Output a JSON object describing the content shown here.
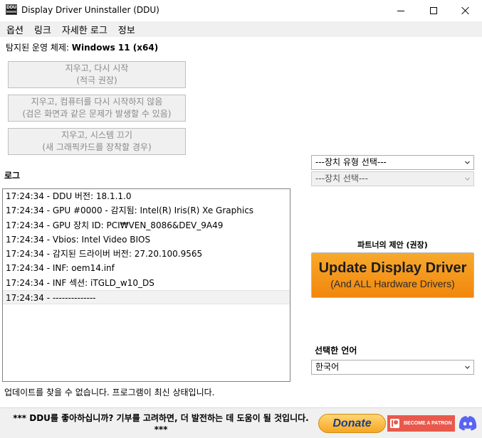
{
  "window": {
    "title": "Display Driver Uninstaller (DDU)",
    "icon_text": "DDU"
  },
  "menu": [
    "옵션",
    "링크",
    "자세한 로그",
    "정보"
  ],
  "os": {
    "label": "탐지된 운영 체제:",
    "value": "Windows 11 (x64)"
  },
  "buttons": {
    "clean_restart": [
      "지우고, 다시 시작",
      "(적극 권장)"
    ],
    "clean_no_restart": [
      "지우고, 컴퓨터를 다시 시작하지 않음",
      "(검은 화면과 같은 문제가 발생할 수 있음)"
    ],
    "clean_shutdown": [
      "지우고, 시스템 끄기",
      "(새 그래픽카드를 장착할 경우)"
    ]
  },
  "device_type_select": "---장치 유형 선택---",
  "device_select": "---장치 선택---",
  "log": {
    "label": "로그",
    "lines": [
      "17:24:34 - DDU 버전: 18.1.1.0",
      "17:24:34 - GPU #0000 - 감지됨: Intel(R) Iris(R) Xe Graphics",
      "17:24:34 - GPU 장치 ID: PCI₩VEN_8086&DEV_9A49",
      "17:24:34 - Vbios: Intel Video BIOS",
      "17:24:34 - 감지된 드라이버 버전: 27.20.100.9565",
      "17:24:34 - INF: oem14.inf",
      "17:24:34 - INF 섹션: iTGLD_w10_DS",
      "17:24:34 - --------------"
    ]
  },
  "partner": {
    "label": "파트너의 제안 (권장)",
    "ad_title": "Update Display Driver",
    "ad_subtitle": "(And ALL Hardware Drivers)"
  },
  "language": {
    "label": "선택한 언어",
    "value": "한국어"
  },
  "status": "업데이트를 찾을 수 없습니다. 프로그램이 최신 상태입니다.",
  "footer": {
    "message_line1": "*** DDU를 좋아하십니까? 기부를 고려하면, 더 발전하는 데 도움이 될 것입니다.",
    "message_line2": "***",
    "donate_label": "Donate",
    "patreon_label": "BECOME A PATRON"
  },
  "colors": {
    "ad_orange": "#f1870d",
    "patreon_red": "#e8594c",
    "discord_blurple": "#5865f2",
    "donate_text": "#1b3d87"
  }
}
